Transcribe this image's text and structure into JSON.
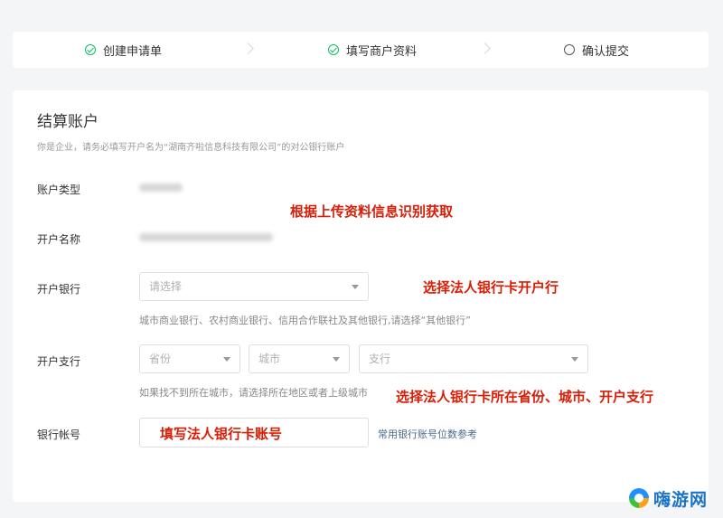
{
  "steps": [
    {
      "label": "创建申请单",
      "status": "done"
    },
    {
      "label": "填写商户资料",
      "status": "done"
    },
    {
      "label": "确认提交",
      "status": "todo"
    }
  ],
  "section": {
    "title": "结算账户",
    "subtitle": "你是企业，请务必填写开户名为“湖南齐啦信息科技有限公司”的对公银行账户"
  },
  "fields": {
    "account_type_label": "账户类型",
    "account_name_label": "开户名称",
    "bank_label": "开户银行",
    "bank_placeholder": "请选择",
    "bank_hint": "城市商业银行、农村商业银行、信用合作联社及其他银行,请选择“其他银行”",
    "branch_label": "开户支行",
    "province_placeholder": "省份",
    "city_placeholder": "城市",
    "branch_placeholder": "支行",
    "branch_hint": "如果找不到所在城市，请选择所在地区或者上级城市",
    "account_no_label": "银行帐号",
    "account_no_link": "常用银行账号位数参考"
  },
  "annotations": {
    "auto_fill": "根据上传资料信息识别获取",
    "select_bank": "选择法人银行卡开户行",
    "select_branch": "选择法人银行卡所在省份、城市、开户支行",
    "fill_account": "填写法人银行卡账号"
  },
  "watermark": {
    "text": "嗨游网",
    "icon": "brand-logo-icon"
  },
  "colors": {
    "success": "#07c160",
    "annotation": "#d81e06",
    "link": "#4a6a8a",
    "brand": "#1a73c8"
  }
}
